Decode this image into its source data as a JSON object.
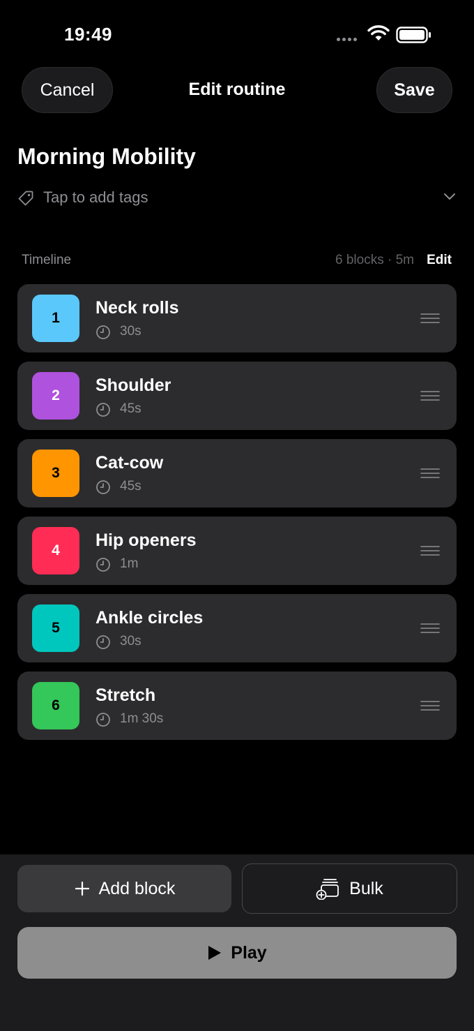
{
  "status_bar": {
    "time": "19:49"
  },
  "nav": {
    "cancel_label": "Cancel",
    "title": "Edit routine",
    "save_label": "Save"
  },
  "routine": {
    "title": "Morning Mobility",
    "tags_placeholder": "Tap to add tags"
  },
  "timeline": {
    "label": "Timeline",
    "meta": "6 blocks · 5m",
    "edit_label": "Edit",
    "blocks": [
      {
        "index": "1",
        "name": "Neck rolls",
        "duration": "30s",
        "color": "#5ac8fa",
        "text_color": "#000000"
      },
      {
        "index": "2",
        "name": "Shoulder",
        "duration": "45s",
        "color": "#af52de",
        "text_color": "#ffffff"
      },
      {
        "index": "3",
        "name": "Cat-cow",
        "duration": "45s",
        "color": "#ff9500",
        "text_color": "#000000"
      },
      {
        "index": "4",
        "name": "Hip openers",
        "duration": "1m",
        "color": "#ff2d55",
        "text_color": "#ffffff"
      },
      {
        "index": "5",
        "name": "Ankle circles",
        "duration": "30s",
        "color": "#00c7be",
        "text_color": "#000000"
      },
      {
        "index": "6",
        "name": "Stretch",
        "duration": "1m 30s",
        "color": "#34c759",
        "text_color": "#000000"
      }
    ]
  },
  "actions": {
    "add_block_label": "Add block",
    "bulk_label": "Bulk",
    "play_label": "Play"
  }
}
